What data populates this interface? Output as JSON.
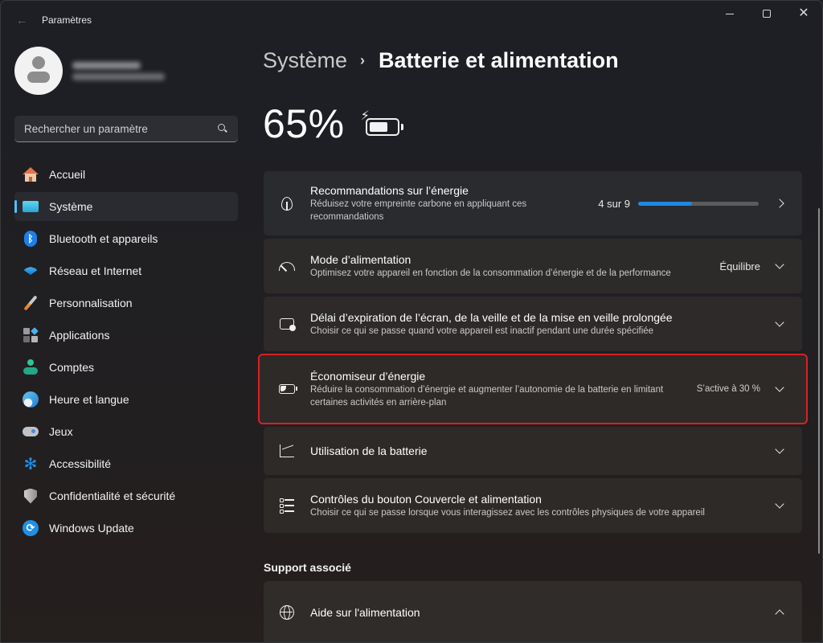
{
  "window": {
    "title": "Paramètres",
    "controls": {
      "minimize": "minimize",
      "maximize": "maximize",
      "close": "✕"
    }
  },
  "sidebar": {
    "search": {
      "placeholder": "Rechercher un paramètre"
    },
    "items": [
      {
        "label": "Accueil",
        "icon": "home-icon",
        "active": false
      },
      {
        "label": "Système",
        "icon": "system-icon",
        "active": true
      },
      {
        "label": "Bluetooth et appareils",
        "icon": "bluetooth-icon",
        "active": false
      },
      {
        "label": "Réseau et Internet",
        "icon": "wifi-icon",
        "active": false
      },
      {
        "label": "Personnalisation",
        "icon": "brush-icon",
        "active": false
      },
      {
        "label": "Applications",
        "icon": "apps-icon",
        "active": false
      },
      {
        "label": "Comptes",
        "icon": "accounts-icon",
        "active": false
      },
      {
        "label": "Heure et langue",
        "icon": "time-language-icon",
        "active": false
      },
      {
        "label": "Jeux",
        "icon": "gamepad-icon",
        "active": false
      },
      {
        "label": "Accessibilité",
        "icon": "accessibility-icon",
        "active": false
      },
      {
        "label": "Confidentialité et sécurité",
        "icon": "shield-icon",
        "active": false
      },
      {
        "label": "Windows Update",
        "icon": "update-icon",
        "active": false
      }
    ]
  },
  "main": {
    "breadcrumb": {
      "parent": "Système",
      "separator": "›",
      "current": "Batterie et alimentation"
    },
    "battery": {
      "percent_label": "65%",
      "level": 0.65,
      "charging": true
    },
    "cards": [
      {
        "title": "Recommandations sur l’énergie",
        "subtitle": "Réduisez votre empreinte carbone en appliquant ces recommandations",
        "progress_label": "4 sur 9",
        "progress": {
          "done": 4,
          "total": 9
        },
        "icon": "leaf-icon",
        "action": "chevron-right"
      },
      {
        "title": "Mode d’alimentation",
        "subtitle": "Optimisez votre appareil en fonction de la consommation d’énergie et de la performance",
        "value": "Équilibre",
        "icon": "gauge-icon",
        "action": "chevron-down"
      },
      {
        "title": "Délai d’expiration de l’écran, de la veille et de la mise en veille prolongée",
        "subtitle": "Choisir ce qui se passe quand votre appareil est inactif pendant une durée spécifiée",
        "icon": "screen-sleep-icon",
        "action": "chevron-down"
      },
      {
        "title": "Économiseur d’énergie",
        "subtitle": "Réduire la consommation d’énergie et augmenter l’autonomie de la batterie en limitant certaines activités en arrière-plan",
        "value": "S’active à 30 %",
        "icon": "energy-saver-icon",
        "action": "chevron-down",
        "highlighted": true,
        "highlight_color": "#d92027"
      },
      {
        "title": "Utilisation de la batterie",
        "icon": "chart-icon",
        "action": "chevron-down"
      },
      {
        "title": "Contrôles du bouton Couvercle et alimentation",
        "subtitle": "Choisir ce qui se passe lorsque vous interagissez avec les contrôles physiques de votre appareil",
        "icon": "list-icon",
        "action": "chevron-down"
      }
    ],
    "support": {
      "heading": "Support associé",
      "help": {
        "title": "Aide sur l'alimentation",
        "icon": "globe-icon",
        "action": "chevron-up"
      }
    }
  },
  "colors": {
    "accent": "#4cc2ff",
    "progress": "#1e88e5",
    "highlight": "#d92027"
  }
}
